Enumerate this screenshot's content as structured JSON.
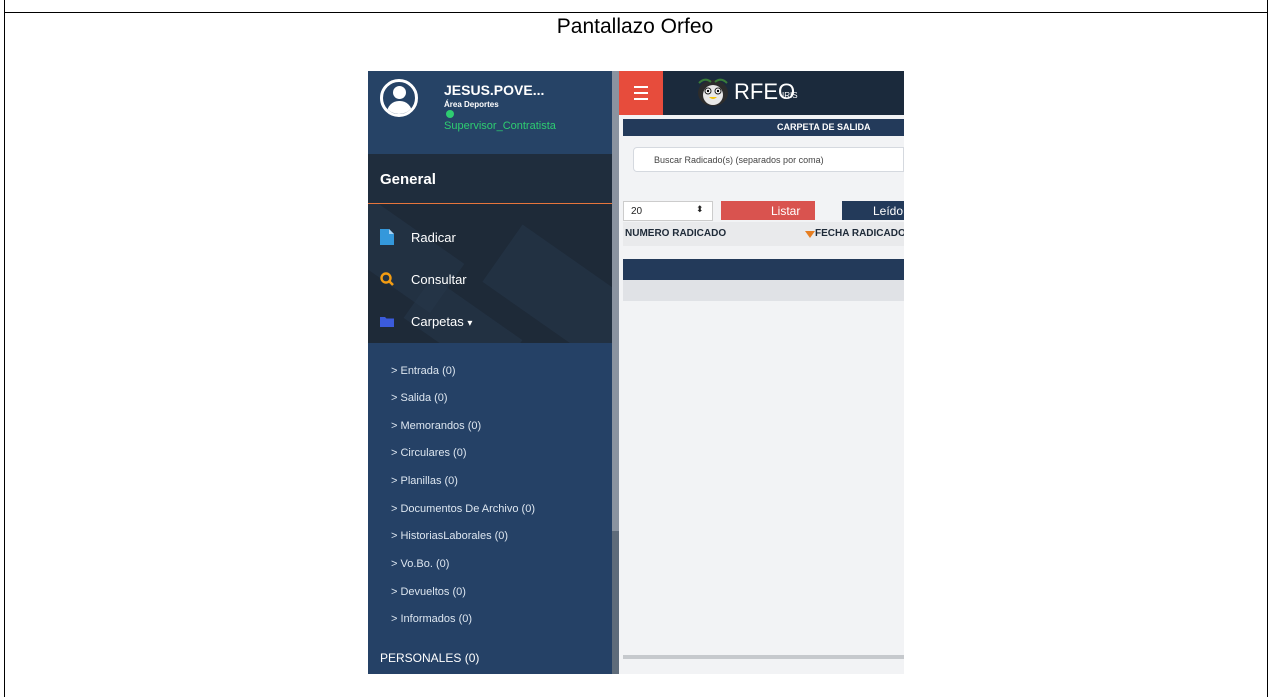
{
  "document": {
    "title": "Pantallazo Orfeo"
  },
  "profile": {
    "name": "JESUS.POVE...",
    "area": "Área Deportes",
    "role": "Supervisor_Contratista"
  },
  "sidebar": {
    "section_title": "General",
    "menu": [
      {
        "label": "Radicar",
        "icon": "document-icon",
        "color": "#3498db"
      },
      {
        "label": "Consultar",
        "icon": "search-icon",
        "color": "#f39c12"
      },
      {
        "label": "Carpetas",
        "icon": "folder-icon",
        "color": "#3b5bdb",
        "caret": "▾"
      }
    ],
    "folders": [
      "> Entrada (0)",
      "> Salida (0)",
      "> Memorandos (0)",
      "> Circulares (0)",
      "> Planillas (0)",
      "> Documentos De Archivo (0)",
      "> HistoriasLaborales (0)",
      "> Vo.Bo. (0)",
      "> Devueltos (0)",
      "> Informados (0)"
    ],
    "personales": "PERSONALES (0)"
  },
  "header": {
    "menu_icon": "hamburger-icon",
    "logo_text": "RFEO",
    "logo_sub": "IRIS"
  },
  "main": {
    "panel_title": "CARPETA DE SALIDA",
    "search_placeholder": "Buscar Radicado(s) (separados por coma)",
    "page_size": "20",
    "list_button": "Listar",
    "read_button": "Leído",
    "columns": [
      "NUMERO RADICADO",
      "FECHA RADICADO"
    ]
  },
  "colors": {
    "sidebar": "#254166",
    "accent_red": "#e74c3c",
    "status_green": "#2ecc71",
    "header_dark": "#1b2a3c"
  }
}
